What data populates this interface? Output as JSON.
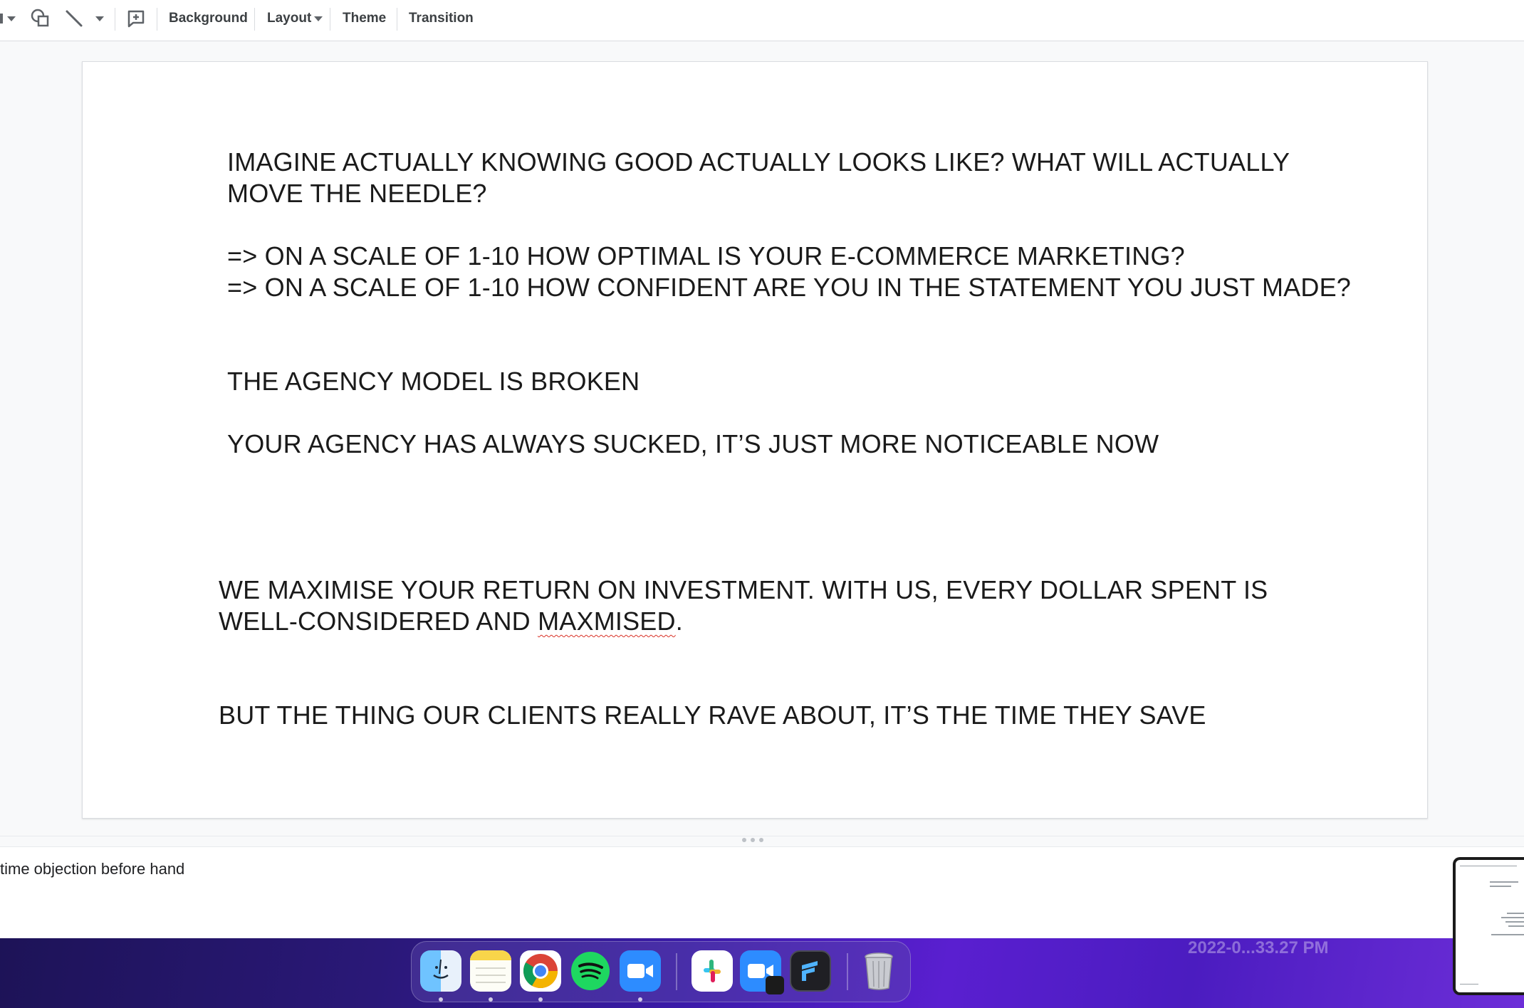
{
  "toolbar": {
    "background_label": "Background",
    "layout_label": "Layout",
    "theme_label": "Theme",
    "transition_label": "Transition"
  },
  "slide": {
    "block1_line1": "IMAGINE ACTUALLY KNOWING GOOD ACTUALLY LOOKS LIKE? WHAT WILL ACTUALLY",
    "block1_line2": "MOVE THE NEEDLE?",
    "block1_line3": "=> ON A SCALE OF 1-10 HOW OPTIMAL IS YOUR E-COMMERCE MARKETING?",
    "block1_line4": "=> ON A SCALE OF 1-10 HOW CONFIDENT ARE YOU IN THE STATEMENT YOU JUST MADE?",
    "block1_line5": "THE AGENCY MODEL IS BROKEN",
    "block1_line6": "YOUR AGENCY HAS ALWAYS SUCKED, IT’S JUST MORE NOTICEABLE NOW",
    "block2_line1": "WE MAXIMISE YOUR RETURN ON INVESTMENT. WITH US, EVERY DOLLAR SPENT IS",
    "block2_line2_a": "WELL-CONSIDERED AND ",
    "block2_line2_misspelled": "MAXMISED",
    "block2_line2_c": ".",
    "block2_line3": "BUT THE THING OUR CLIENTS REALLY RAVE ABOUT, IT’S THE TIME THEY SAVE"
  },
  "notes": {
    "text": "time objection before hand"
  },
  "dock": {
    "apps": [
      "finder-icon",
      "notes-icon",
      "chrome-icon",
      "spotify-icon",
      "zoom-icon",
      "slack-icon",
      "zoom-share-icon",
      "presenter-icon",
      "trash-icon"
    ]
  },
  "desktop": {
    "screenshot_label": "2022-0...33.27 PM"
  },
  "colors": {
    "accent": "#1a73e8",
    "spellcheck": "#d93025",
    "dock_bg": "#3a1aa8"
  }
}
